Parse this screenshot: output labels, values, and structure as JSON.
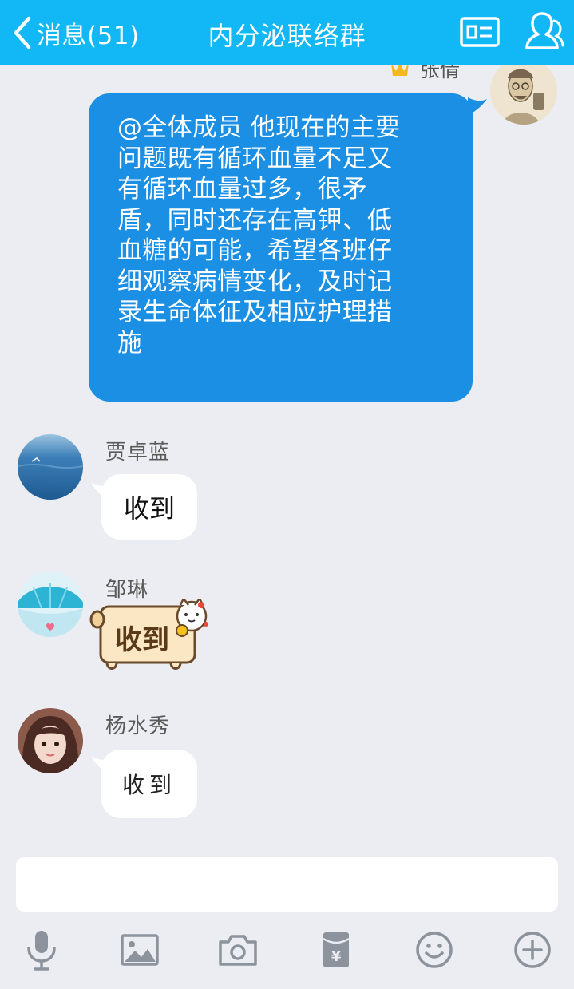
{
  "header": {
    "back_label": "消息(51)",
    "title": "内分泌联络群",
    "colors": {
      "bar": "#12b7f5",
      "text": "#ffffff"
    }
  },
  "icons": {
    "back": "chevron-left-icon",
    "card": "profile-card-icon",
    "members": "group-members-icon"
  },
  "messages": [
    {
      "sender": "张倩",
      "outgoing": true,
      "text": "@全体成员 他现在的主要问题既有循环血量不足又有循环血量过多，很矛盾，同时还存在高钾、低血糖的可能，希望各班仔细观察病情变化，及时记录生命体征及相应护理措施",
      "lines": [
        "@全体成员 他现在的主要",
        "问题既有循环血量不足又",
        "有循环血量过多，很矛",
        "盾，同时还存在高钾、低",
        "血糖的可能，希望各班仔",
        "细观察病情变化，及时记",
        "录生命体征及相应护理措",
        "施"
      ],
      "bubble_color": "#1a8fe3"
    },
    {
      "sender": "贾卓蓝",
      "outgoing": false,
      "text": "收到",
      "kind": "text"
    },
    {
      "sender": "邹琳",
      "outgoing": false,
      "text": "收到",
      "kind": "sticker"
    },
    {
      "sender": "杨水秀",
      "outgoing": false,
      "text": "收到",
      "kind": "handwriting"
    }
  ],
  "input": {
    "value": "",
    "placeholder": ""
  },
  "toolbar": {
    "items": [
      "microphone-icon",
      "image-icon",
      "camera-icon",
      "red-packet-icon",
      "emoji-icon",
      "plus-icon"
    ]
  }
}
